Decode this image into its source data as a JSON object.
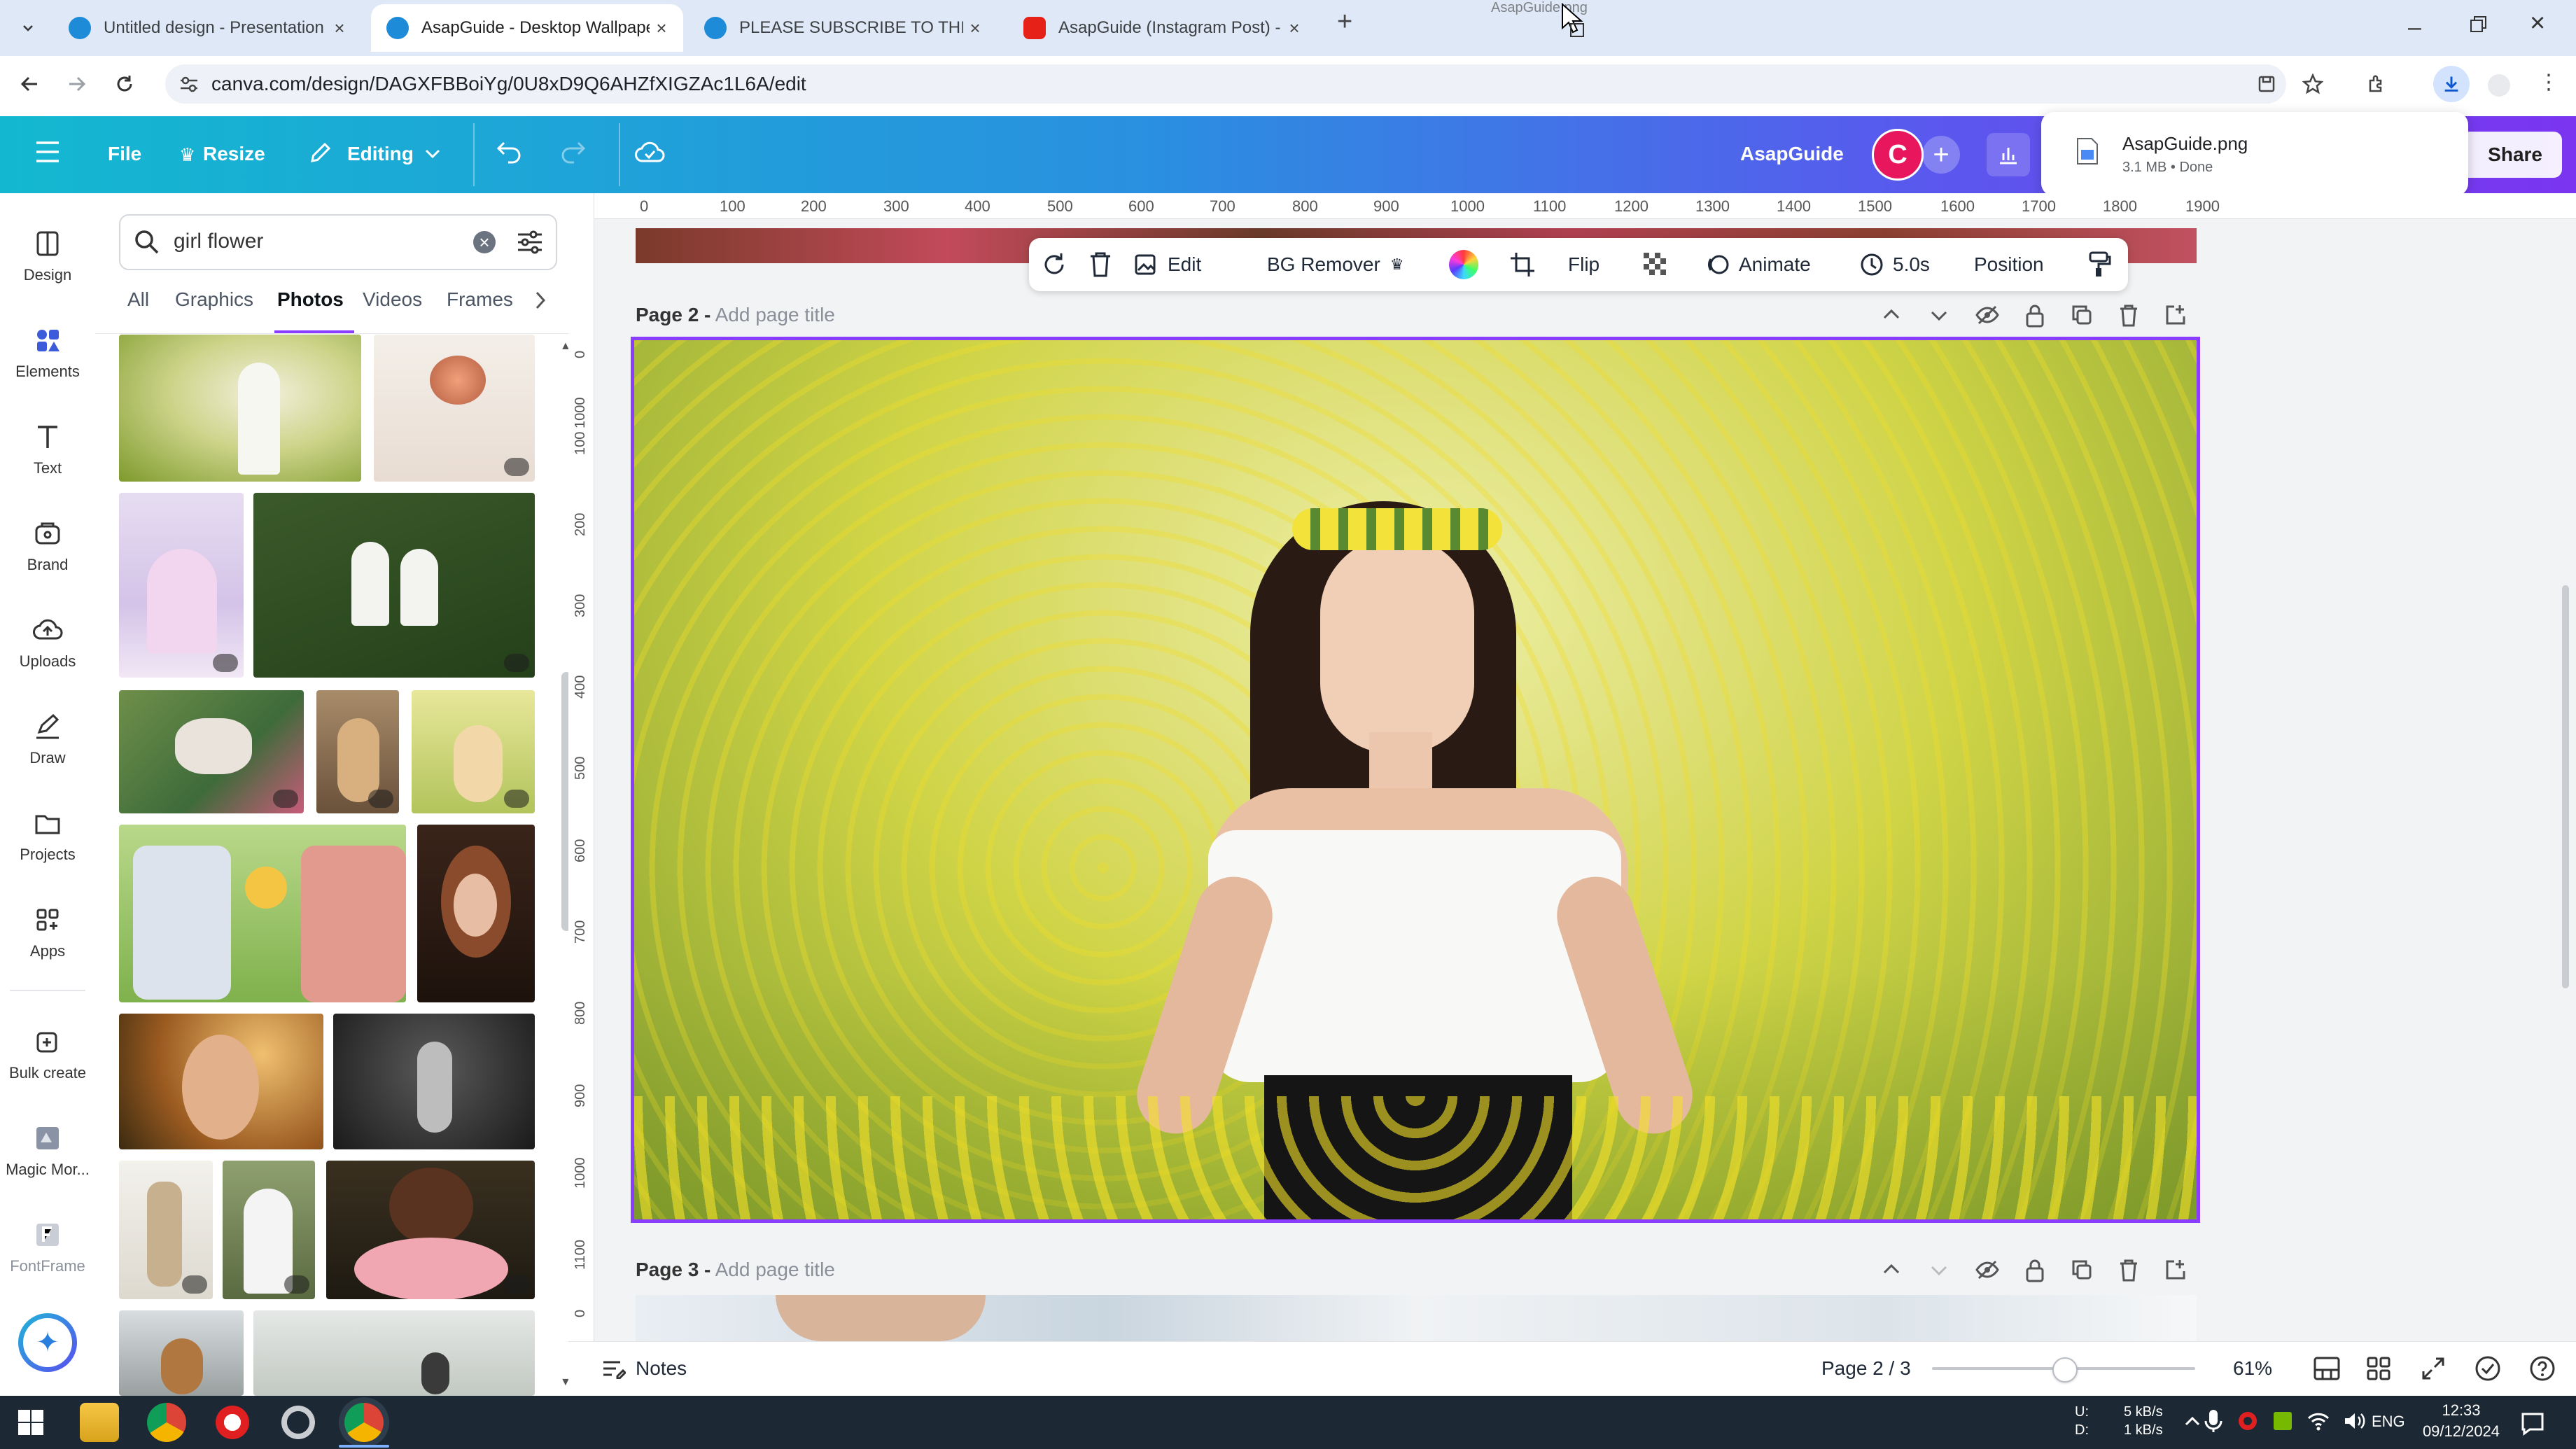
{
  "browser": {
    "tabs": [
      {
        "title": "Untitled design - Presentation",
        "active": false
      },
      {
        "title": "AsapGuide - Desktop Wallpaper",
        "active": true
      },
      {
        "title": "PLEASE SUBSCRIBE TO THIS CH",
        "active": false
      },
      {
        "title": "AsapGuide (Instagram Post) - Y",
        "active": false
      }
    ],
    "new_tab": "+",
    "url": "canva.com/design/DAGXFBBoiYg/0U8xD9Q6AHZfXIGZAc1L6A/edit",
    "drag_ghost": "AsapGuide.png"
  },
  "download": {
    "filename": "AsapGuide.png",
    "meta": "3.1 MB • Done"
  },
  "canva_header": {
    "file": "File",
    "resize": "Resize",
    "editing": "Editing",
    "brand": "AsapGuide",
    "avatar": "C",
    "share": "Share"
  },
  "rail": [
    {
      "label": "Design",
      "icon": "design-icon"
    },
    {
      "label": "Elements",
      "icon": "elements-icon"
    },
    {
      "label": "Text",
      "icon": "text-icon"
    },
    {
      "label": "Brand",
      "icon": "brand-icon"
    },
    {
      "label": "Uploads",
      "icon": "uploads-icon"
    },
    {
      "label": "Draw",
      "icon": "draw-icon"
    },
    {
      "label": "Projects",
      "icon": "projects-icon"
    },
    {
      "label": "Apps",
      "icon": "apps-icon"
    },
    {
      "label": "Bulk create",
      "icon": "bulk-create-icon"
    },
    {
      "label": "Magic Mor...",
      "icon": "magic-morph-icon"
    },
    {
      "label": "FontFrame",
      "icon": "fontframe-icon"
    }
  ],
  "panel": {
    "search_value": "girl flower",
    "tabs": [
      "All",
      "Graphics",
      "Photos",
      "Videos",
      "Frames"
    ],
    "active_tab": "Photos"
  },
  "ruler": {
    "top": [
      "0",
      "100",
      "200",
      "300",
      "400",
      "500",
      "600",
      "700",
      "800",
      "900",
      "1000",
      "1100",
      "1200",
      "1300",
      "1400",
      "1500",
      "1600",
      "1700",
      "1800",
      "1900"
    ],
    "left": [
      "1000",
      "0",
      "100",
      "200",
      "300",
      "400",
      "500",
      "600",
      "700",
      "800",
      "900",
      "1000",
      "1100",
      "0"
    ]
  },
  "context_toolbar": {
    "edit": "Edit",
    "bg_remover": "BG Remover",
    "flip": "Flip",
    "animate": "Animate",
    "duration": "5.0s",
    "position": "Position"
  },
  "pages": [
    {
      "label": "Page 2 -",
      "title_placeholder": "Add page title"
    },
    {
      "label": "Page 3 -",
      "title_placeholder": "Add page title"
    }
  ],
  "footer": {
    "notes": "Notes",
    "page_indicator": "Page 2 / 3",
    "zoom": "61%",
    "zoom_level": 0.61
  },
  "taskbar": {
    "net_up": "5 kB/s",
    "net_down": "1 kB/s",
    "u_label": "U:",
    "d_label": "D:",
    "lang": "ENG",
    "time": "12:33",
    "date": "09/12/2024"
  },
  "colors": {
    "accent": "#8b3dff",
    "header_start": "#13b8d0",
    "header_end": "#7b34f0",
    "avatar": "#e8175d"
  }
}
